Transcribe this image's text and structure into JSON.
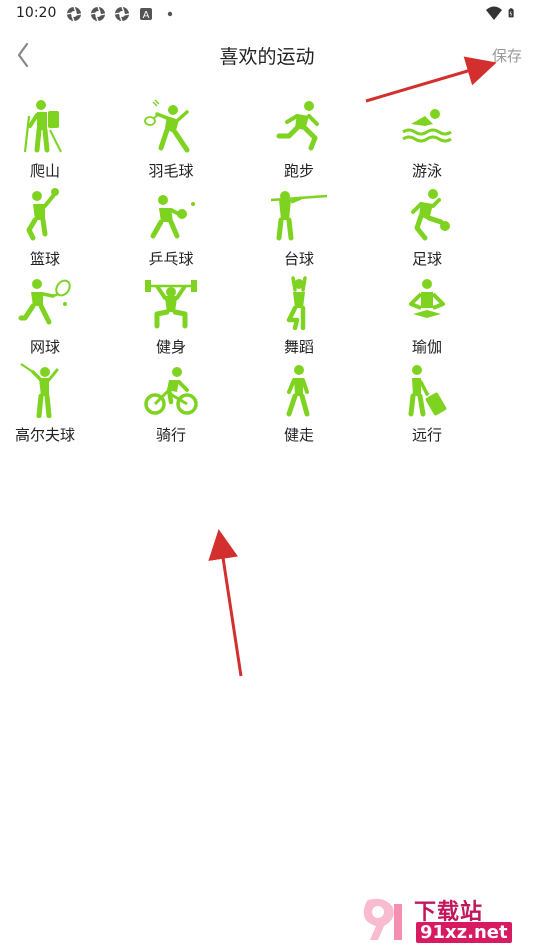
{
  "status_bar": {
    "time": "10:20",
    "left_icons": [
      "aperture-icon",
      "aperture-icon",
      "aperture-icon",
      "a-box-icon",
      "dot-icon"
    ],
    "right_icons": [
      "wifi-icon",
      "battery-icon"
    ]
  },
  "header": {
    "back_icon": "chevron-left-icon",
    "title": "喜欢的运动",
    "save_label": "保存"
  },
  "theme": {
    "icon_color": "#7ed321",
    "arrow_color": "#d32f2f",
    "save_color": "#999999"
  },
  "sports": [
    {
      "label": "爬山",
      "icon": "hiking-icon"
    },
    {
      "label": "羽毛球",
      "icon": "badminton-icon"
    },
    {
      "label": "跑步",
      "icon": "running-icon"
    },
    {
      "label": "游泳",
      "icon": "swimming-icon"
    },
    {
      "label": "篮球",
      "icon": "basketball-icon"
    },
    {
      "label": "乒乓球",
      "icon": "table-tennis-icon"
    },
    {
      "label": "台球",
      "icon": "billiards-icon"
    },
    {
      "label": "足球",
      "icon": "soccer-icon"
    },
    {
      "label": "网球",
      "icon": "tennis-icon"
    },
    {
      "label": "健身",
      "icon": "weightlifting-icon"
    },
    {
      "label": "舞蹈",
      "icon": "dance-icon"
    },
    {
      "label": "瑜伽",
      "icon": "yoga-icon"
    },
    {
      "label": "高尔夫球",
      "icon": "golf-icon"
    },
    {
      "label": "骑行",
      "icon": "cycling-icon"
    },
    {
      "label": "健走",
      "icon": "walking-icon"
    },
    {
      "label": "远行",
      "icon": "travel-icon"
    }
  ],
  "watermark": {
    "title": "下载站",
    "subtitle": "91xz.net"
  }
}
